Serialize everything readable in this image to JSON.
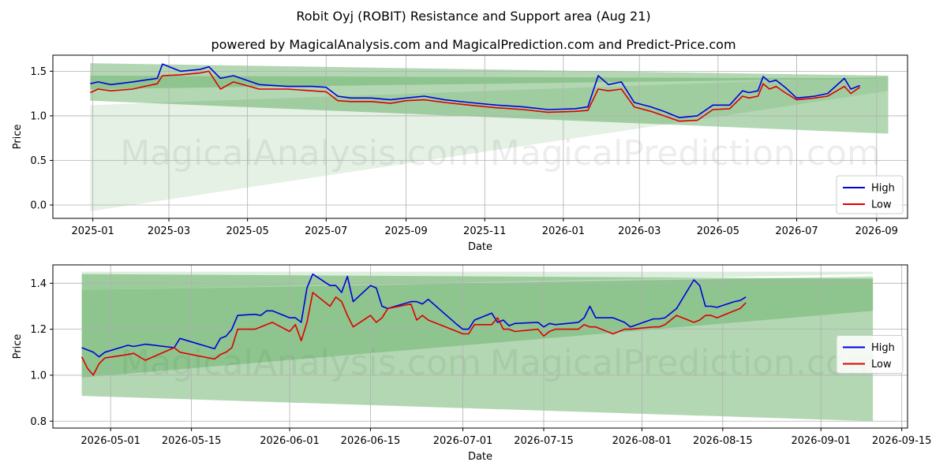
{
  "header": {
    "title": "Robit Oyj (ROBIT) Resistance and Support area (Aug 21)",
    "subtitle": "powered by MagicalAnalysis.com and MagicalPrediction.com and Predict-Price.com"
  },
  "watermarks": [
    "MagicalAnalysis.com",
    "MagicalPrediction.com"
  ],
  "colors": {
    "high": "#0000dd",
    "low": "#dd0000",
    "band": "#228b22",
    "grid": "#b0b0b0"
  },
  "chart_data": [
    {
      "type": "line",
      "xlabel": "Date",
      "ylabel": "Price",
      "x_type": "date",
      "xlim": [
        "2024-12-01",
        "2026-09-25"
      ],
      "ylim": [
        -0.15,
        1.68
      ],
      "x_ticks": [
        "2025-01-01",
        "2025-03-01",
        "2025-05-01",
        "2025-07-01",
        "2025-09-01",
        "2025-11-01",
        "2026-01-01",
        "2026-03-01",
        "2026-05-01",
        "2026-07-01",
        "2026-09-01"
      ],
      "x_tick_labels": [
        "2025-01",
        "2025-03",
        "2025-05",
        "2025-07",
        "2025-09",
        "2025-11",
        "2026-01",
        "2026-03",
        "2026-05",
        "2026-07",
        "2026-09"
      ],
      "y_ticks": [
        0.0,
        0.5,
        1.0,
        1.5
      ],
      "y_tick_labels": [
        "0.0",
        "0.5",
        "1.0",
        "1.5"
      ],
      "grid": true,
      "legend": {
        "position": "lower-right",
        "entries": [
          "High",
          "Low"
        ]
      },
      "bands": [
        {
          "x": [
            "2024-12-30",
            "2026-09-10"
          ],
          "upper": [
            1.59,
            1.45
          ],
          "lower": [
            1.17,
            0.8
          ],
          "opacity": 0.35
        },
        {
          "x": [
            "2024-12-30",
            "2026-09-10"
          ],
          "upper": [
            1.45,
            1.42
          ],
          "lower": [
            1.3,
            1.42
          ],
          "opacity": 0.25
        },
        {
          "x": [
            "2024-12-30",
            "2026-09-10"
          ],
          "upper": [
            1.12,
            1.44
          ],
          "lower": [
            -0.07,
            1.28
          ],
          "opacity": 0.12
        }
      ],
      "series": [
        {
          "name": "High",
          "color": "#0000dd",
          "x": [
            "2024-12-30",
            "2025-01-05",
            "2025-01-15",
            "2025-02-01",
            "2025-02-10",
            "2025-02-20",
            "2025-02-24",
            "2025-03-10",
            "2025-03-25",
            "2025-04-01",
            "2025-04-10",
            "2025-04-20",
            "2025-05-10",
            "2025-06-01",
            "2025-06-20",
            "2025-07-01",
            "2025-07-10",
            "2025-07-20",
            "2025-08-05",
            "2025-08-20",
            "2025-09-01",
            "2025-09-15",
            "2025-10-01",
            "2025-10-20",
            "2025-11-10",
            "2025-12-01",
            "2025-12-20",
            "2026-01-10",
            "2026-01-20",
            "2026-01-28",
            "2026-02-05",
            "2026-02-15",
            "2026-02-25",
            "2026-03-10",
            "2026-03-20",
            "2026-04-01",
            "2026-04-15",
            "2026-04-27",
            "2026-05-10",
            "2026-05-20",
            "2026-05-25",
            "2026-06-01",
            "2026-06-05",
            "2026-06-10",
            "2026-06-15",
            "2026-06-22",
            "2026-07-01",
            "2026-07-15",
            "2026-07-25",
            "2026-08-07",
            "2026-08-12",
            "2026-08-19"
          ],
          "y": [
            1.36,
            1.38,
            1.35,
            1.38,
            1.4,
            1.42,
            1.58,
            1.5,
            1.52,
            1.55,
            1.42,
            1.45,
            1.35,
            1.33,
            1.33,
            1.32,
            1.22,
            1.2,
            1.2,
            1.18,
            1.2,
            1.22,
            1.18,
            1.15,
            1.12,
            1.1,
            1.07,
            1.08,
            1.1,
            1.45,
            1.35,
            1.38,
            1.15,
            1.1,
            1.05,
            0.98,
            1.0,
            1.12,
            1.12,
            1.28,
            1.26,
            1.28,
            1.44,
            1.38,
            1.4,
            1.32,
            1.2,
            1.22,
            1.25,
            1.42,
            1.3,
            1.34
          ]
        },
        {
          "name": "Low",
          "color": "#dd0000",
          "x": [
            "2024-12-30",
            "2025-01-05",
            "2025-01-15",
            "2025-02-01",
            "2025-02-10",
            "2025-02-20",
            "2025-02-24",
            "2025-03-10",
            "2025-03-25",
            "2025-04-01",
            "2025-04-10",
            "2025-04-20",
            "2025-05-10",
            "2025-06-01",
            "2025-06-20",
            "2025-07-01",
            "2025-07-10",
            "2025-07-20",
            "2025-08-05",
            "2025-08-20",
            "2025-09-01",
            "2025-09-15",
            "2025-10-01",
            "2025-10-20",
            "2025-11-10",
            "2025-12-01",
            "2025-12-20",
            "2026-01-10",
            "2026-01-20",
            "2026-01-28",
            "2026-02-05",
            "2026-02-15",
            "2026-02-25",
            "2026-03-10",
            "2026-03-20",
            "2026-04-01",
            "2026-04-15",
            "2026-04-27",
            "2026-05-10",
            "2026-05-20",
            "2026-05-25",
            "2026-06-01",
            "2026-06-05",
            "2026-06-10",
            "2026-06-15",
            "2026-06-22",
            "2026-07-01",
            "2026-07-15",
            "2026-07-25",
            "2026-08-07",
            "2026-08-12",
            "2026-08-19"
          ],
          "y": [
            1.26,
            1.3,
            1.28,
            1.3,
            1.33,
            1.36,
            1.45,
            1.46,
            1.48,
            1.5,
            1.3,
            1.38,
            1.3,
            1.3,
            1.28,
            1.27,
            1.17,
            1.16,
            1.16,
            1.14,
            1.17,
            1.18,
            1.15,
            1.12,
            1.09,
            1.07,
            1.04,
            1.05,
            1.06,
            1.3,
            1.28,
            1.3,
            1.1,
            1.05,
            1.0,
            0.94,
            0.95,
            1.07,
            1.08,
            1.22,
            1.2,
            1.22,
            1.36,
            1.3,
            1.33,
            1.26,
            1.18,
            1.2,
            1.22,
            1.33,
            1.25,
            1.32
          ]
        }
      ]
    },
    {
      "type": "line",
      "xlabel": "Date",
      "ylabel": "Price",
      "x_type": "date",
      "xlim": [
        "2026-04-21",
        "2026-09-16"
      ],
      "ylim": [
        0.77,
        1.48
      ],
      "x_ticks": [
        "2026-05-01",
        "2026-05-15",
        "2026-06-01",
        "2026-06-15",
        "2026-07-01",
        "2026-07-15",
        "2026-08-01",
        "2026-08-15",
        "2026-09-01",
        "2026-09-15"
      ],
      "x_tick_labels": [
        "2026-05-01",
        "2026-05-15",
        "2026-06-01",
        "2026-06-15",
        "2026-07-01",
        "2026-07-15",
        "2026-08-01",
        "2026-08-15",
        "2026-09-01",
        "2026-09-15"
      ],
      "y_ticks": [
        0.8,
        1.0,
        1.2,
        1.4
      ],
      "y_tick_labels": [
        "0.8",
        "1.0",
        "1.2",
        "1.4"
      ],
      "grid": true,
      "legend": {
        "position": "center-right",
        "entries": [
          "High",
          "Low"
        ]
      },
      "bands": [
        {
          "x": [
            "2026-04-26",
            "2026-09-10"
          ],
          "upper": [
            1.44,
            1.42
          ],
          "lower": [
            0.91,
            0.8
          ],
          "opacity": 0.35
        },
        {
          "x": [
            "2026-04-26",
            "2026-09-10"
          ],
          "upper": [
            1.45,
            1.45
          ],
          "lower": [
            1.37,
            1.44
          ],
          "opacity": 0.15
        },
        {
          "x": [
            "2026-04-26",
            "2026-09-10"
          ],
          "upper": [
            1.37,
            1.43
          ],
          "lower": [
            0.99,
            1.28
          ],
          "opacity": 0.25
        }
      ],
      "series": [
        {
          "name": "High",
          "color": "#0000dd",
          "x": [
            "2026-04-26",
            "2026-04-27",
            "2026-04-28",
            "2026-04-29",
            "2026-04-30",
            "2026-05-04",
            "2026-05-05",
            "2026-05-07",
            "2026-05-12",
            "2026-05-13",
            "2026-05-19",
            "2026-05-20",
            "2026-05-21",
            "2026-05-22",
            "2026-05-23",
            "2026-05-26",
            "2026-05-27",
            "2026-05-28",
            "2026-05-29",
            "2026-06-01",
            "2026-06-02",
            "2026-06-03",
            "2026-06-04",
            "2026-06-05",
            "2026-06-08",
            "2026-06-09",
            "2026-06-10",
            "2026-06-11",
            "2026-06-12",
            "2026-06-15",
            "2026-06-16",
            "2026-06-17",
            "2026-06-18",
            "2026-06-22",
            "2026-06-23",
            "2026-06-24",
            "2026-06-25",
            "2026-06-30",
            "2026-07-01",
            "2026-07-02",
            "2026-07-03",
            "2026-07-06",
            "2026-07-07",
            "2026-07-08",
            "2026-07-09",
            "2026-07-10",
            "2026-07-14",
            "2026-07-15",
            "2026-07-16",
            "2026-07-17",
            "2026-07-21",
            "2026-07-22",
            "2026-07-23",
            "2026-07-24",
            "2026-07-27",
            "2026-07-29",
            "2026-07-30",
            "2026-08-03",
            "2026-08-04",
            "2026-08-05",
            "2026-08-07",
            "2026-08-10",
            "2026-08-11",
            "2026-08-12",
            "2026-08-13",
            "2026-08-14",
            "2026-08-17",
            "2026-08-18",
            "2026-08-19"
          ],
          "y": [
            1.12,
            1.11,
            1.1,
            1.08,
            1.1,
            1.13,
            1.125,
            1.135,
            1.12,
            1.16,
            1.115,
            1.16,
            1.17,
            1.2,
            1.26,
            1.265,
            1.26,
            1.28,
            1.28,
            1.25,
            1.25,
            1.23,
            1.38,
            1.44,
            1.39,
            1.39,
            1.36,
            1.43,
            1.32,
            1.39,
            1.38,
            1.3,
            1.29,
            1.32,
            1.32,
            1.31,
            1.33,
            1.22,
            1.2,
            1.2,
            1.24,
            1.27,
            1.23,
            1.24,
            1.215,
            1.225,
            1.23,
            1.21,
            1.225,
            1.22,
            1.23,
            1.25,
            1.3,
            1.25,
            1.25,
            1.23,
            1.21,
            1.245,
            1.245,
            1.25,
            1.29,
            1.415,
            1.39,
            1.3,
            1.3,
            1.295,
            1.32,
            1.325,
            1.34
          ]
        },
        {
          "name": "Low",
          "color": "#dd0000",
          "x": [
            "2026-04-26",
            "2026-04-27",
            "2026-04-28",
            "2026-04-29",
            "2026-04-30",
            "2026-05-04",
            "2026-05-05",
            "2026-05-07",
            "2026-05-12",
            "2026-05-13",
            "2026-05-19",
            "2026-05-20",
            "2026-05-21",
            "2026-05-22",
            "2026-05-23",
            "2026-05-26",
            "2026-05-27",
            "2026-05-28",
            "2026-05-29",
            "2026-06-01",
            "2026-06-02",
            "2026-06-03",
            "2026-06-04",
            "2026-06-05",
            "2026-06-08",
            "2026-06-09",
            "2026-06-10",
            "2026-06-11",
            "2026-06-12",
            "2026-06-15",
            "2026-06-16",
            "2026-06-17",
            "2026-06-18",
            "2026-06-22",
            "2026-06-23",
            "2026-06-24",
            "2026-06-25",
            "2026-06-30",
            "2026-07-01",
            "2026-07-02",
            "2026-07-03",
            "2026-07-06",
            "2026-07-07",
            "2026-07-08",
            "2026-07-09",
            "2026-07-10",
            "2026-07-14",
            "2026-07-15",
            "2026-07-16",
            "2026-07-17",
            "2026-07-21",
            "2026-07-22",
            "2026-07-23",
            "2026-07-24",
            "2026-07-27",
            "2026-07-29",
            "2026-07-30",
            "2026-08-03",
            "2026-08-04",
            "2026-08-05",
            "2026-08-07",
            "2026-08-10",
            "2026-08-11",
            "2026-08-12",
            "2026-08-13",
            "2026-08-14",
            "2026-08-17",
            "2026-08-18",
            "2026-08-19"
          ],
          "y": [
            1.08,
            1.03,
            1.0,
            1.05,
            1.075,
            1.09,
            1.095,
            1.065,
            1.12,
            1.1,
            1.07,
            1.09,
            1.1,
            1.12,
            1.2,
            1.2,
            1.21,
            1.22,
            1.23,
            1.19,
            1.22,
            1.15,
            1.23,
            1.36,
            1.3,
            1.34,
            1.32,
            1.26,
            1.21,
            1.26,
            1.23,
            1.25,
            1.29,
            1.31,
            1.24,
            1.26,
            1.24,
            1.19,
            1.18,
            1.18,
            1.22,
            1.22,
            1.25,
            1.2,
            1.2,
            1.19,
            1.2,
            1.17,
            1.19,
            1.2,
            1.2,
            1.22,
            1.21,
            1.21,
            1.18,
            1.2,
            1.2,
            1.21,
            1.21,
            1.22,
            1.26,
            1.23,
            1.24,
            1.26,
            1.26,
            1.25,
            1.28,
            1.29,
            1.315
          ]
        }
      ]
    }
  ]
}
